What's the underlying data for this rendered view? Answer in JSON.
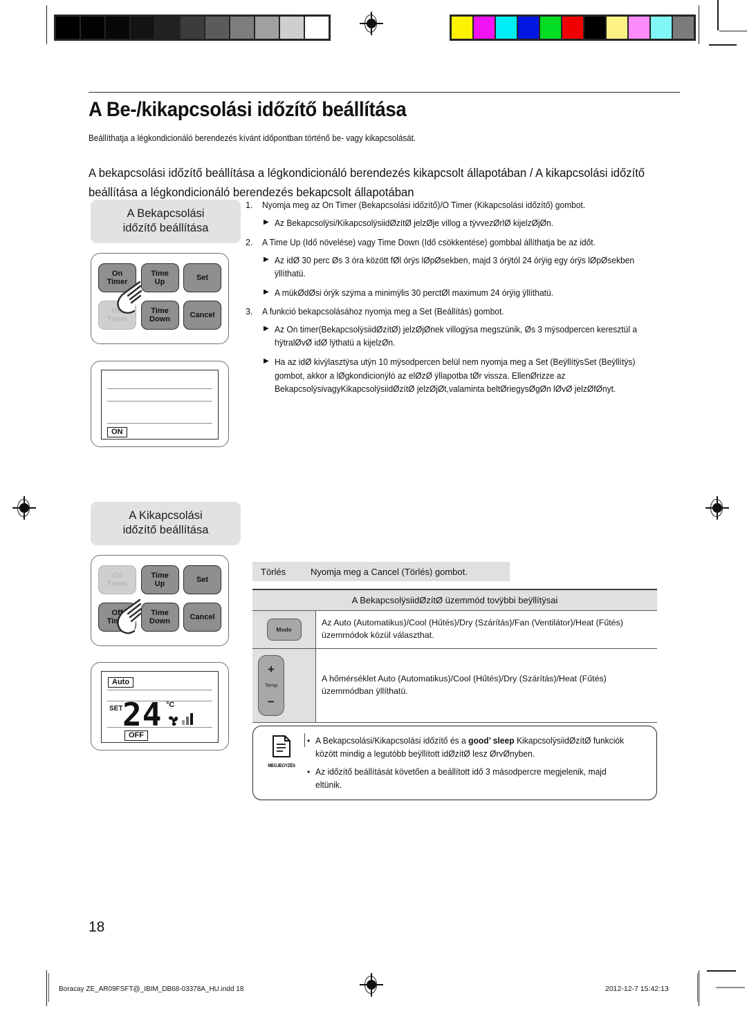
{
  "document": {
    "page_title": "A Be-/kikapcsolási időzítő beállítása",
    "lead": "Beállíthatja a légkondicionáló berendezés kívánt időpontban történő be- vagy kikapcsolását.",
    "subheading": "A bekapcsolási időzítő beállítása a légkondicionáló berendezés kikapcsolt állapotában / A kikapcsolási időzítő beállítása a légkondicionáló berendezés bekapcsolt állapotában",
    "page_number": "18"
  },
  "sections": {
    "on_timer": {
      "pill_line1": "A Bekapcsolási",
      "pill_line2": "időzítő beállítása",
      "lcd_tag": "ON"
    },
    "off_timer": {
      "pill_line1": "A Kikapcsolási",
      "pill_line2": "időzítő beállítása",
      "lcd_mode_tag": "Auto",
      "lcd_set_label": "SET",
      "lcd_temperature": "24",
      "lcd_unit": "°C",
      "lcd_tag": "OFF"
    }
  },
  "remote_keys": {
    "on_timer_l1": "On",
    "on_timer_l2": "Timer",
    "off_timer_l1": "Off",
    "off_timer_l2": "Timer",
    "time_up_l1": "Time",
    "time_up_l2": "Up",
    "time_down_l1": "Time",
    "time_down_l2": "Down",
    "set": "Set",
    "cancel": "Cancel"
  },
  "steps": [
    {
      "num": "1.",
      "text": "Nyomja meg az On Timer (Bekapcsolási időzítő)/O  Timer  (Kikapcsolási időzítő) gombot.",
      "bullets": [
        "Az Bekapcsolÿsi/KikapcsolÿsiidØzítØ jelzØje villog a tÿvvezØrlØ kijelzØjØn."
      ]
    },
    {
      "num": "2.",
      "text": "A Time Up (Idő növelése) vagy Time Down (Idő csökkentése) gombbal állíthatja be az időt.",
      "bullets": [
        "Az idØ 30 perc Øs 3 óra között fØl órÿs lØpØsekben, majd 3 órÿtól 24 órÿig egy órÿs lØpØsekben ÿllíthatü.",
        "A mükØdØsi órÿk szÿma a minimÿlis 30 perctØl maximum 24 órÿig ÿllíthatü."
      ]
    },
    {
      "num": "3.",
      "text": "A funkció bekapcsolásához nyomja meg a Set (Beállítás) gombot.",
      "bullets": [
        "Az On timer(BekapcsolÿsiidØzítØ) jelzØjØnek villogÿsa megszünik, Øs 3 mÿsodpercen keresztül a hÿtralØvØ idØ lÿthatü a kijelzØn.",
        "Ha az idØ kivÿlasztÿsa utÿn 10 mÿsodpercen belül nem nyomja meg a Set (BeÿllítÿsSet (Beÿllítÿs) gombot, akkor a lØgkondicionÿló az elØzØ ÿllapotba tØr vissza. EllenØrizze az BekapcsolÿsivagyKikapcsolÿsiidØzítØ jelzØjØt,valaminta beltØriegysØgØn lØvØ jelzØfØnyt."
      ]
    }
  ],
  "cancel_strip": {
    "label": "Törlés",
    "text": "Nyomja meg a Cancel (Törlés) gombot."
  },
  "spec_table": {
    "header": "A BekapcsolÿsiidØzítØ üzemmód tovÿbbi beÿllítÿsai",
    "rows": [
      {
        "icon": "mode-button",
        "icon_label": "Mode",
        "text": "Az Auto (Automatikus)/Cool (Hűtés)/Dry (Szárítás)/Fan (Ventilátor)/Heat (Fűtés) üzemmódok közül választhat."
      },
      {
        "icon": "temp-button",
        "icon_plus": "+",
        "icon_minus": "−",
        "icon_label": "Temp",
        "text": "A hőmérséklet Auto (Automatikus)/Cool (Hűtés)/Dry (Szárítás)/Heat (Fűtés) üzemmódban ÿllíthatü."
      }
    ]
  },
  "note": {
    "icon_label": "MEGJEGYZÉS",
    "items": [
      {
        "pre": "A Bekapcsolási/Kikapcsolási időzítő és a ",
        "bold": "good’ sleep",
        "post": " KikapcsolÿsiidØzítØ funkciók között mindig a legutóbb beÿllított idØzítØ lesz ØrvØnyben."
      },
      {
        "pre": "Az időzítő beállítását követően a beállított idő 3 másodpercre megjelenik, majd eltünik.",
        "bold": "",
        "post": ""
      }
    ]
  },
  "footer": {
    "left": "Boracay ZE_AR09FSFT@_IBIM_DB68-03378A_HU.indd   18",
    "right": "2012-12-7   15:42:13"
  },
  "calibration": {
    "gray_swatches": [
      "#000000",
      "#030303",
      "#080808",
      "#131313",
      "#212121",
      "#3c3c3c",
      "#5b5b5b",
      "#7d7d7d",
      "#a0a0a0",
      "#cfcfcf",
      "#ffffff"
    ],
    "color_swatches": [
      "#fff200",
      "#f113f1",
      "#00eef5",
      "#0018e0",
      "#00dd22",
      "#f00000",
      "#000000",
      "#fdf385",
      "#fb8bfb",
      "#81f7f7",
      "#7b7b7b"
    ]
  }
}
